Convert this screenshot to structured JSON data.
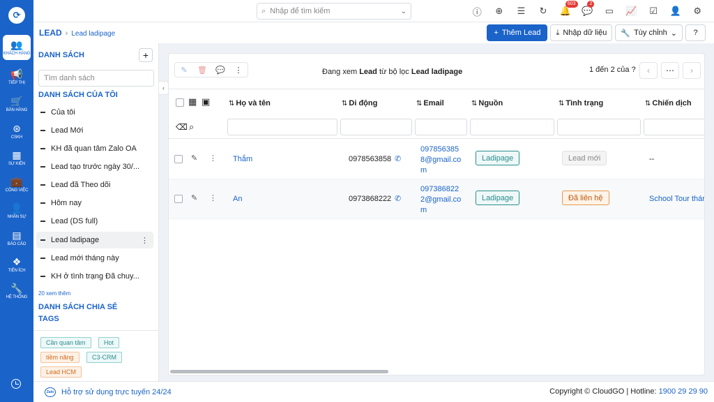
{
  "search": {
    "placeholder": "Nhập để tìm kiếm"
  },
  "topbar": {
    "notifications_badge": "603",
    "messages_badge": "2"
  },
  "rail": [
    {
      "label": "KHÁCH HÀNG",
      "icon": "users-icon"
    },
    {
      "label": "TIẾP THỊ",
      "icon": "megaphone-icon"
    },
    {
      "label": "BÁN HÀNG",
      "icon": "cart-icon"
    },
    {
      "label": "CSKH",
      "icon": "lifebuoy-icon"
    },
    {
      "label": "SỰ KIỆN",
      "icon": "calendar-icon"
    },
    {
      "label": "CÔNG VIỆC",
      "icon": "briefcase-icon"
    },
    {
      "label": "NHÂN SỰ",
      "icon": "person-icon"
    },
    {
      "label": "BÁO CÁO",
      "icon": "report-icon"
    },
    {
      "label": "TIỆN ÍCH",
      "icon": "boxes-icon"
    },
    {
      "label": "HỆ THỐNG",
      "icon": "wrench-icon"
    }
  ],
  "breadcrumb": {
    "module": "LEAD",
    "current": "Lead ladipage"
  },
  "actions": {
    "add": "Thêm Lead",
    "import": "Nhập dữ liệu",
    "customize": "Tùy chỉnh"
  },
  "sidebar": {
    "lists_title": "DANH SÁCH",
    "search_placeholder": "Tìm danh sách",
    "my_lists_title": "DANH SÁCH CỦA TÔI",
    "items": [
      "Của tôi",
      "Lead Mới",
      "KH đã quan tâm Zalo OA",
      "Lead tạo trước ngày 30/...",
      "Lead đã Theo dõi",
      "Hôm nay",
      "Lead (DS full)",
      "Lead ladipage",
      "Lead mới tháng này",
      "KH ở tình trạng Đã chuy..."
    ],
    "see_more": "20 xem thêm",
    "shared_title": "DANH SÁCH CHIA SẺ",
    "tags_title": "TAGS",
    "tags": [
      {
        "label": "Cần quan tâm",
        "color": "#2a8d8d",
        "bg": "#eef8f8"
      },
      {
        "label": "Hot",
        "color": "#2a8d8d",
        "bg": "#eef8f8"
      },
      {
        "label": "tiềm năng",
        "color": "#d46a1b",
        "bg": "#fdf1e6"
      },
      {
        "label": "C3-CRM",
        "color": "#2a8d8d",
        "bg": "#eef8f8"
      },
      {
        "label": "Lead HCM",
        "color": "#d46a1b",
        "bg": "#fdf1e6"
      }
    ]
  },
  "toolbar": {
    "viewing_prefix": "Đang xem",
    "viewing_module": "Lead",
    "viewing_mid": "từ bộ lọc",
    "viewing_filter": "Lead ladipage",
    "pager": "1 đến 2 của"
  },
  "table": {
    "columns": [
      "Họ và tên",
      "Di động",
      "Email",
      "Nguồn",
      "Tình trạng",
      "Chiến dịch"
    ],
    "rows": [
      {
        "name": "Thắm",
        "mobile": "0978563858",
        "email_lines": [
          "097856385",
          "8@gmail.co",
          "m"
        ],
        "source": "Ladipage",
        "status": "Lead mới",
        "campaign": "--"
      },
      {
        "name": "An",
        "mobile": "0973868222",
        "email_lines": [
          "097386822",
          "2@gmail.co",
          "m"
        ],
        "source": "Ladipage",
        "status": "Đã liên hệ",
        "campaign": "School Tour thán"
      }
    ]
  },
  "footer": {
    "zalo": "Zalo",
    "support": "Hỗ trợ sử dụng trực tuyến 24/24",
    "copyright": "Copyright © CloudGO",
    "hotline_label": "Hotline:",
    "hotline": "1900 29 29 90"
  },
  "colors": {
    "brand": "#1a63c9",
    "source_pill": "#2a8d8d",
    "status_new": "#888888",
    "status_contacted": "#d46a1b"
  }
}
